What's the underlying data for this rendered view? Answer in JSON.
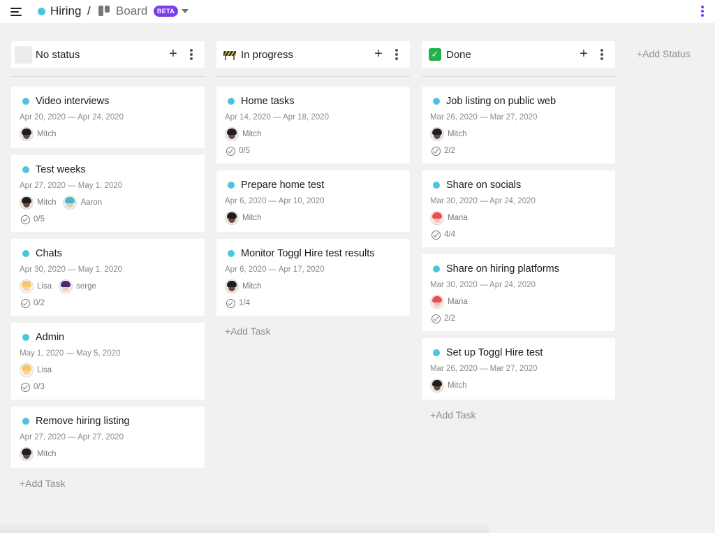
{
  "topbar": {
    "project": "Hiring",
    "separator": "/",
    "view": "Board",
    "beta": "BETA",
    "project_color": "#4cc4e0",
    "beta_color": "#7b3ee8",
    "kebab_color": "#7b3ee8"
  },
  "columns": [
    {
      "title": "No status",
      "icon": "empty-square-icon",
      "add_label": "+",
      "add_task": "+Add Task",
      "cards": [
        {
          "title": "Video interviews",
          "dates": "Apr 20, 2020 — Apr 24, 2020",
          "people": [
            {
              "name": "Mitch",
              "avatar": "mitch"
            }
          ],
          "checklist": ""
        },
        {
          "title": "Test weeks",
          "dates": "Apr 27, 2020 — May 1, 2020",
          "people": [
            {
              "name": "Mitch",
              "avatar": "mitch"
            },
            {
              "name": "Aaron",
              "avatar": "aaron"
            }
          ],
          "checklist": "0/5"
        },
        {
          "title": "Chats",
          "dates": "Apr 30, 2020 — May 1, 2020",
          "people": [
            {
              "name": "Lisa",
              "avatar": "lisa"
            },
            {
              "name": "serge",
              "avatar": "serge"
            }
          ],
          "checklist": "0/2"
        },
        {
          "title": "Admin",
          "dates": "May 1, 2020 — May 5, 2020",
          "people": [
            {
              "name": "Lisa",
              "avatar": "lisa"
            }
          ],
          "checklist": "0/3"
        },
        {
          "title": "Remove hiring listing",
          "dates": "Apr 27, 2020 — Apr 27, 2020",
          "people": [
            {
              "name": "Mitch",
              "avatar": "mitch"
            }
          ],
          "checklist": ""
        }
      ]
    },
    {
      "title": "In progress",
      "icon": "construction-icon",
      "add_label": "+",
      "add_task": "+Add Task",
      "cards": [
        {
          "title": "Home tasks",
          "dates": "Apr 14, 2020 — Apr 18, 2020",
          "people": [
            {
              "name": "Mitch",
              "avatar": "mitch"
            }
          ],
          "checklist": "0/5"
        },
        {
          "title": "Prepare home test",
          "dates": "Apr 6, 2020 — Apr 10, 2020",
          "people": [
            {
              "name": "Mitch",
              "avatar": "mitch"
            }
          ],
          "checklist": ""
        },
        {
          "title": "Monitor Toggl Hire test results",
          "dates": "Apr 6, 2020 — Apr 17, 2020",
          "people": [
            {
              "name": "Mitch",
              "avatar": "mitch"
            }
          ],
          "checklist": "1/4"
        }
      ]
    },
    {
      "title": "Done",
      "icon": "check-mark-icon",
      "add_label": "+",
      "add_task": "+Add Task",
      "cards": [
        {
          "title": "Job listing on public web",
          "dates": "Mar 26, 2020 — Mar 27, 2020",
          "people": [
            {
              "name": "Mitch",
              "avatar": "mitch"
            }
          ],
          "checklist": "2/2"
        },
        {
          "title": "Share on socials",
          "dates": "Mar 30, 2020 — Apr 24, 2020",
          "people": [
            {
              "name": "Maria",
              "avatar": "maria"
            }
          ],
          "checklist": "4/4"
        },
        {
          "title": "Share on hiring platforms",
          "dates": "Mar 30, 2020 — Apr 24, 2020",
          "people": [
            {
              "name": "Maria",
              "avatar": "maria"
            }
          ],
          "checklist": "2/2"
        },
        {
          "title": "Set up Toggl Hire test",
          "dates": "Mar 26, 2020 — Mar 27, 2020",
          "people": [
            {
              "name": "Mitch",
              "avatar": "mitch"
            }
          ],
          "checklist": ""
        }
      ]
    }
  ],
  "add_status": "+Add Status",
  "colors": {
    "card_dot": "#4cc4e0",
    "done_icon": "#22b14c"
  }
}
